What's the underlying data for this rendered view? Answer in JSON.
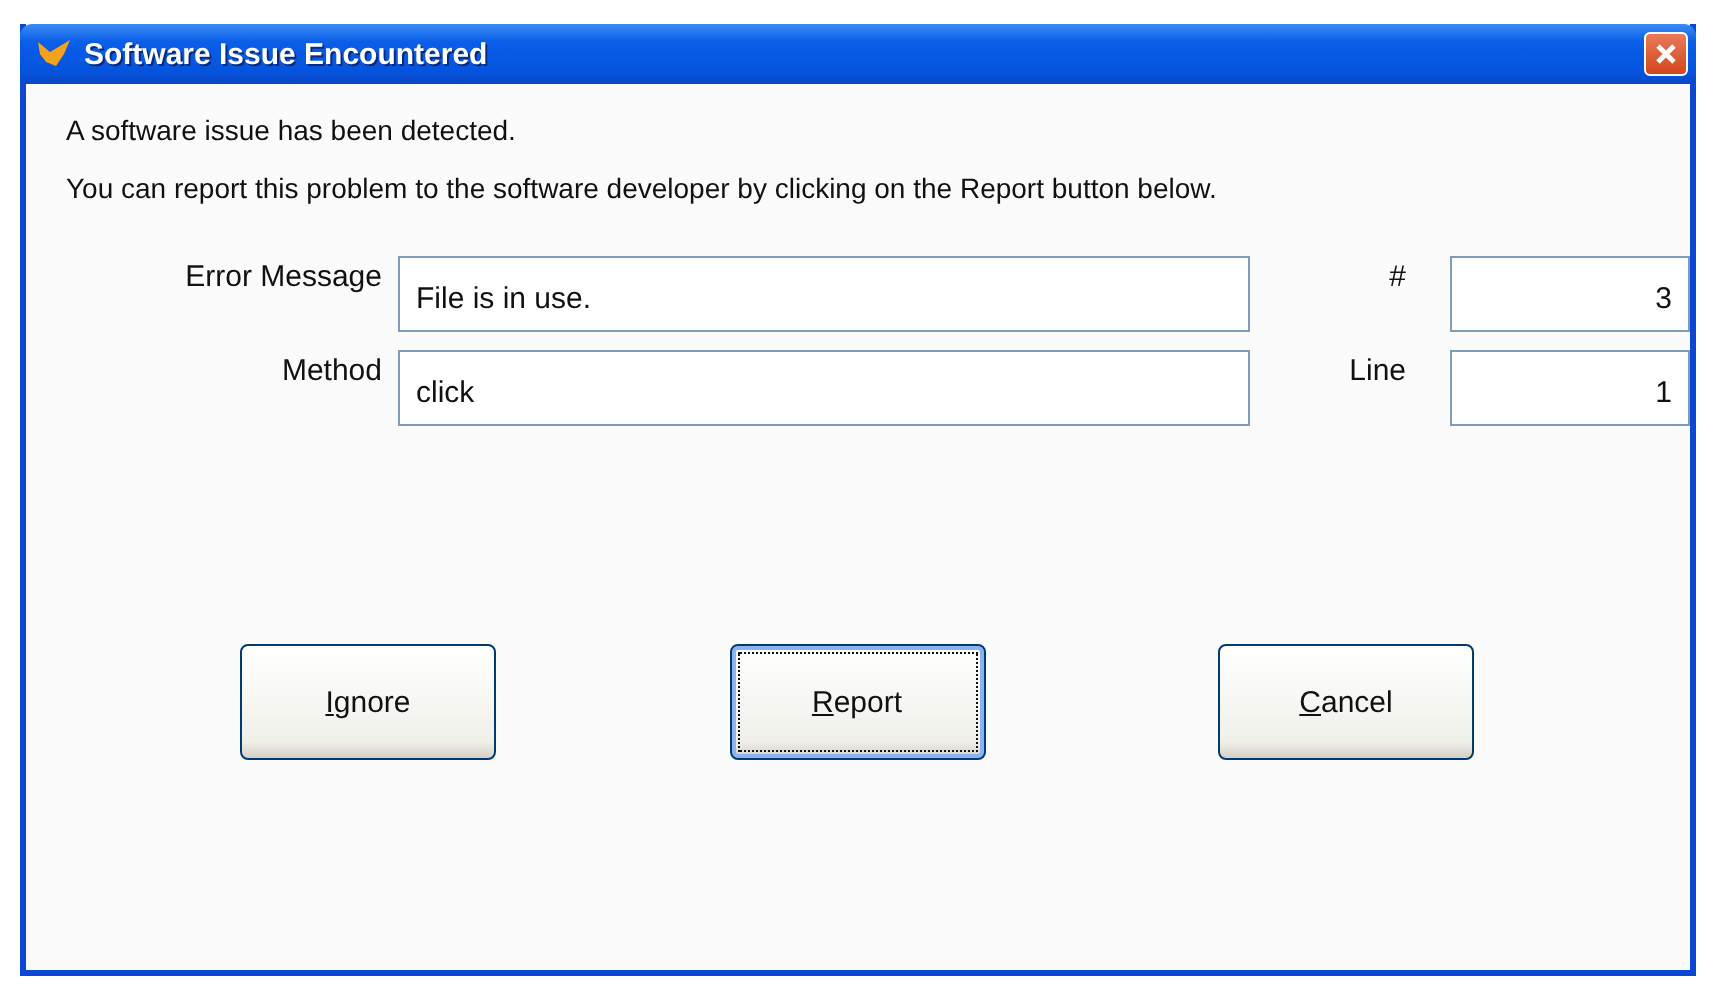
{
  "window": {
    "title": "Software Issue Encountered"
  },
  "messages": [
    "A software issue has been detected.",
    "You can report this problem to the software developer by clicking on the Report button below."
  ],
  "fields": [
    {
      "label": "Error Message",
      "value": "File is in use.",
      "side_label": "#",
      "side_value": "3"
    },
    {
      "label": "Method",
      "value": "click",
      "side_label": "Line",
      "side_value": "1"
    }
  ],
  "buttons": [
    {
      "label": "Ignore",
      "default": false
    },
    {
      "label": "Report",
      "default": true
    },
    {
      "label": "Cancel",
      "default": false
    }
  ]
}
